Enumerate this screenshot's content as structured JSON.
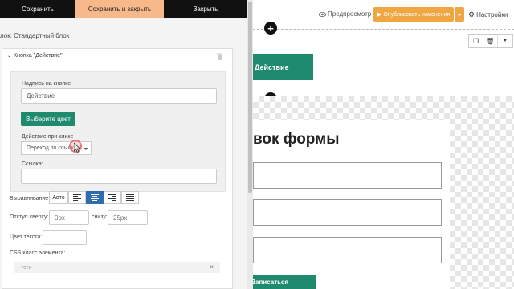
{
  "topbar": {
    "save_label": "Сохранить",
    "save_close_label": "Сохранить и закрыть",
    "close_label": "Закрыть"
  },
  "editor": {
    "block_title": "лок: Стандартный блок",
    "card_title": "Кнопка \"Действие\"",
    "button_text_label": "Надпись на кнопке",
    "button_text_value": "Действие",
    "choose_color_label": "Выберите цвет",
    "click_action_label": "Действие при клике",
    "click_action_value": "Переход по ссылке",
    "link_label": "Ссылка:",
    "link_value": "",
    "align_label": "Выравнивание",
    "align_auto_label": "Авто",
    "indent_top_label": "Отступ сверху:",
    "indent_top_placeholder": "0px",
    "indent_bottom_label": "снизу:",
    "indent_bottom_placeholder": "25px",
    "text_color_label": "Цвет текста:",
    "css_class_label": "CSS класс элемента:",
    "tags_placeholder": "теги",
    "tags_clear": "×"
  },
  "preview": {
    "preview_label": "Предпросмотр",
    "publish_label": "▶ Опубликовать изменения",
    "settings_label": "Настройки",
    "action_button_label": "Действие",
    "form_title": "вок формы",
    "submit_label": "Записаться"
  },
  "colors": {
    "accent_green": "#1f8a6e",
    "publish_orange": "#f0a742",
    "active_tab_bg": "#f7b98a",
    "align_active": "#2f6db0"
  }
}
